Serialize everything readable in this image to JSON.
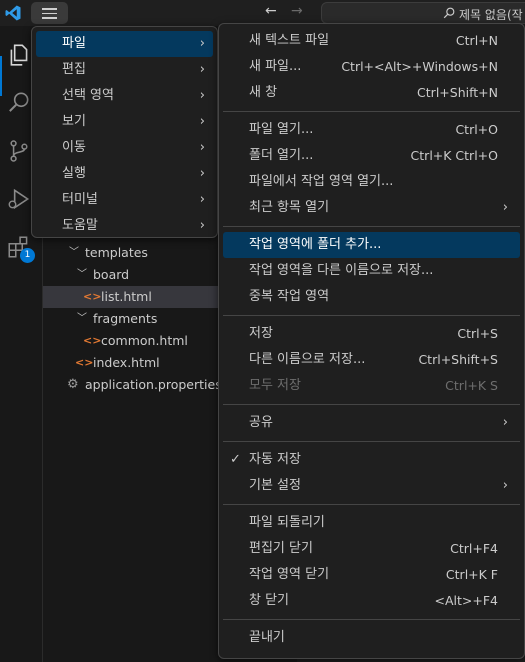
{
  "titlebar": {
    "command_center_text": "제목 없음(작"
  },
  "activity_bar": {
    "extensions_badge": "1"
  },
  "explorer": {
    "rows": [
      {
        "label": "templates",
        "type": "folder"
      },
      {
        "label": "board",
        "type": "folder"
      },
      {
        "label": "list.html",
        "type": "html",
        "selected": true
      },
      {
        "label": "fragments",
        "type": "folder"
      },
      {
        "label": "common.html",
        "type": "html"
      },
      {
        "label": "index.html",
        "type": "html"
      },
      {
        "label": "application.properties",
        "type": "properties"
      }
    ]
  },
  "menubar": {
    "items": [
      {
        "label": "파일",
        "active": true
      },
      {
        "label": "편집"
      },
      {
        "label": "선택 영역"
      },
      {
        "label": "보기"
      },
      {
        "label": "이동"
      },
      {
        "label": "실행"
      },
      {
        "label": "터미널"
      },
      {
        "label": "도움말"
      }
    ]
  },
  "file_menu": {
    "groups": [
      [
        {
          "label": "새 텍스트 파일",
          "shortcut": "Ctrl+N"
        },
        {
          "label": "새 파일...",
          "shortcut": "Ctrl+<Alt>+Windows+N"
        },
        {
          "label": "새 창",
          "shortcut": "Ctrl+Shift+N"
        }
      ],
      [
        {
          "label": "파일 열기...",
          "shortcut": "Ctrl+O"
        },
        {
          "label": "폴더 열기...",
          "shortcut": "Ctrl+K Ctrl+O"
        },
        {
          "label": "파일에서 작업 영역 열기...",
          "shortcut": ""
        },
        {
          "label": "최근 항목 열기",
          "shortcut": "",
          "submenu": true
        }
      ],
      [
        {
          "label": "작업 영역에 폴더 추가...",
          "shortcut": "",
          "active": true
        },
        {
          "label": "작업 영역을 다른 이름으로 저장...",
          "shortcut": ""
        },
        {
          "label": "중복 작업 영역",
          "shortcut": ""
        }
      ],
      [
        {
          "label": "저장",
          "shortcut": "Ctrl+S"
        },
        {
          "label": "다른 이름으로 저장...",
          "shortcut": "Ctrl+Shift+S"
        },
        {
          "label": "모두 저장",
          "shortcut": "Ctrl+K S",
          "disabled": true
        }
      ],
      [
        {
          "label": "공유",
          "shortcut": "",
          "submenu": true
        }
      ],
      [
        {
          "label": "자동 저장",
          "shortcut": "",
          "checked": true
        },
        {
          "label": "기본 설정",
          "shortcut": "",
          "submenu": true
        }
      ],
      [
        {
          "label": "파일 되돌리기",
          "shortcut": ""
        },
        {
          "label": "편집기 닫기",
          "shortcut": "Ctrl+F4"
        },
        {
          "label": "작업 영역 닫기",
          "shortcut": "Ctrl+K F"
        },
        {
          "label": "창 닫기",
          "shortcut": "<Alt>+F4"
        }
      ],
      [
        {
          "label": "끝내기",
          "shortcut": ""
        }
      ]
    ]
  },
  "colors": {
    "accent": "#0078d4",
    "menu_highlight": "#04395e",
    "menu_bg": "#1f1f1f",
    "html_icon": "#e37933"
  }
}
